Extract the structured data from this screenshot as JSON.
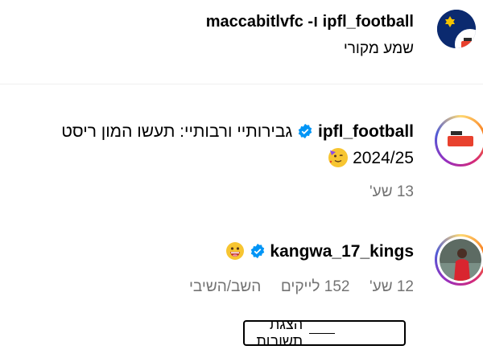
{
  "header": {
    "title": "ipfl_football ו- maccabitlvfc",
    "subtitle": "שמע מקורי"
  },
  "caption": {
    "username": "ipfl_football",
    "text": "גבירותיי ורבותיי: תעשו המון ריסט",
    "line2": "2024/25",
    "time": "13 שע'"
  },
  "comment": {
    "username": "kangwa_17_kings",
    "time": "12 שע'",
    "likes": "152 לייקים",
    "reply": "השב/השיבי",
    "view_replies": "הצגת תשובות"
  },
  "colors": {
    "verified": "#0095f6",
    "muted": "#737373",
    "divider": "#efefef"
  },
  "icons": {
    "verified": "verified-badge-icon",
    "emoji_caption": "party-face-emoji",
    "emoji_comment": "grinning-face-emoji"
  }
}
